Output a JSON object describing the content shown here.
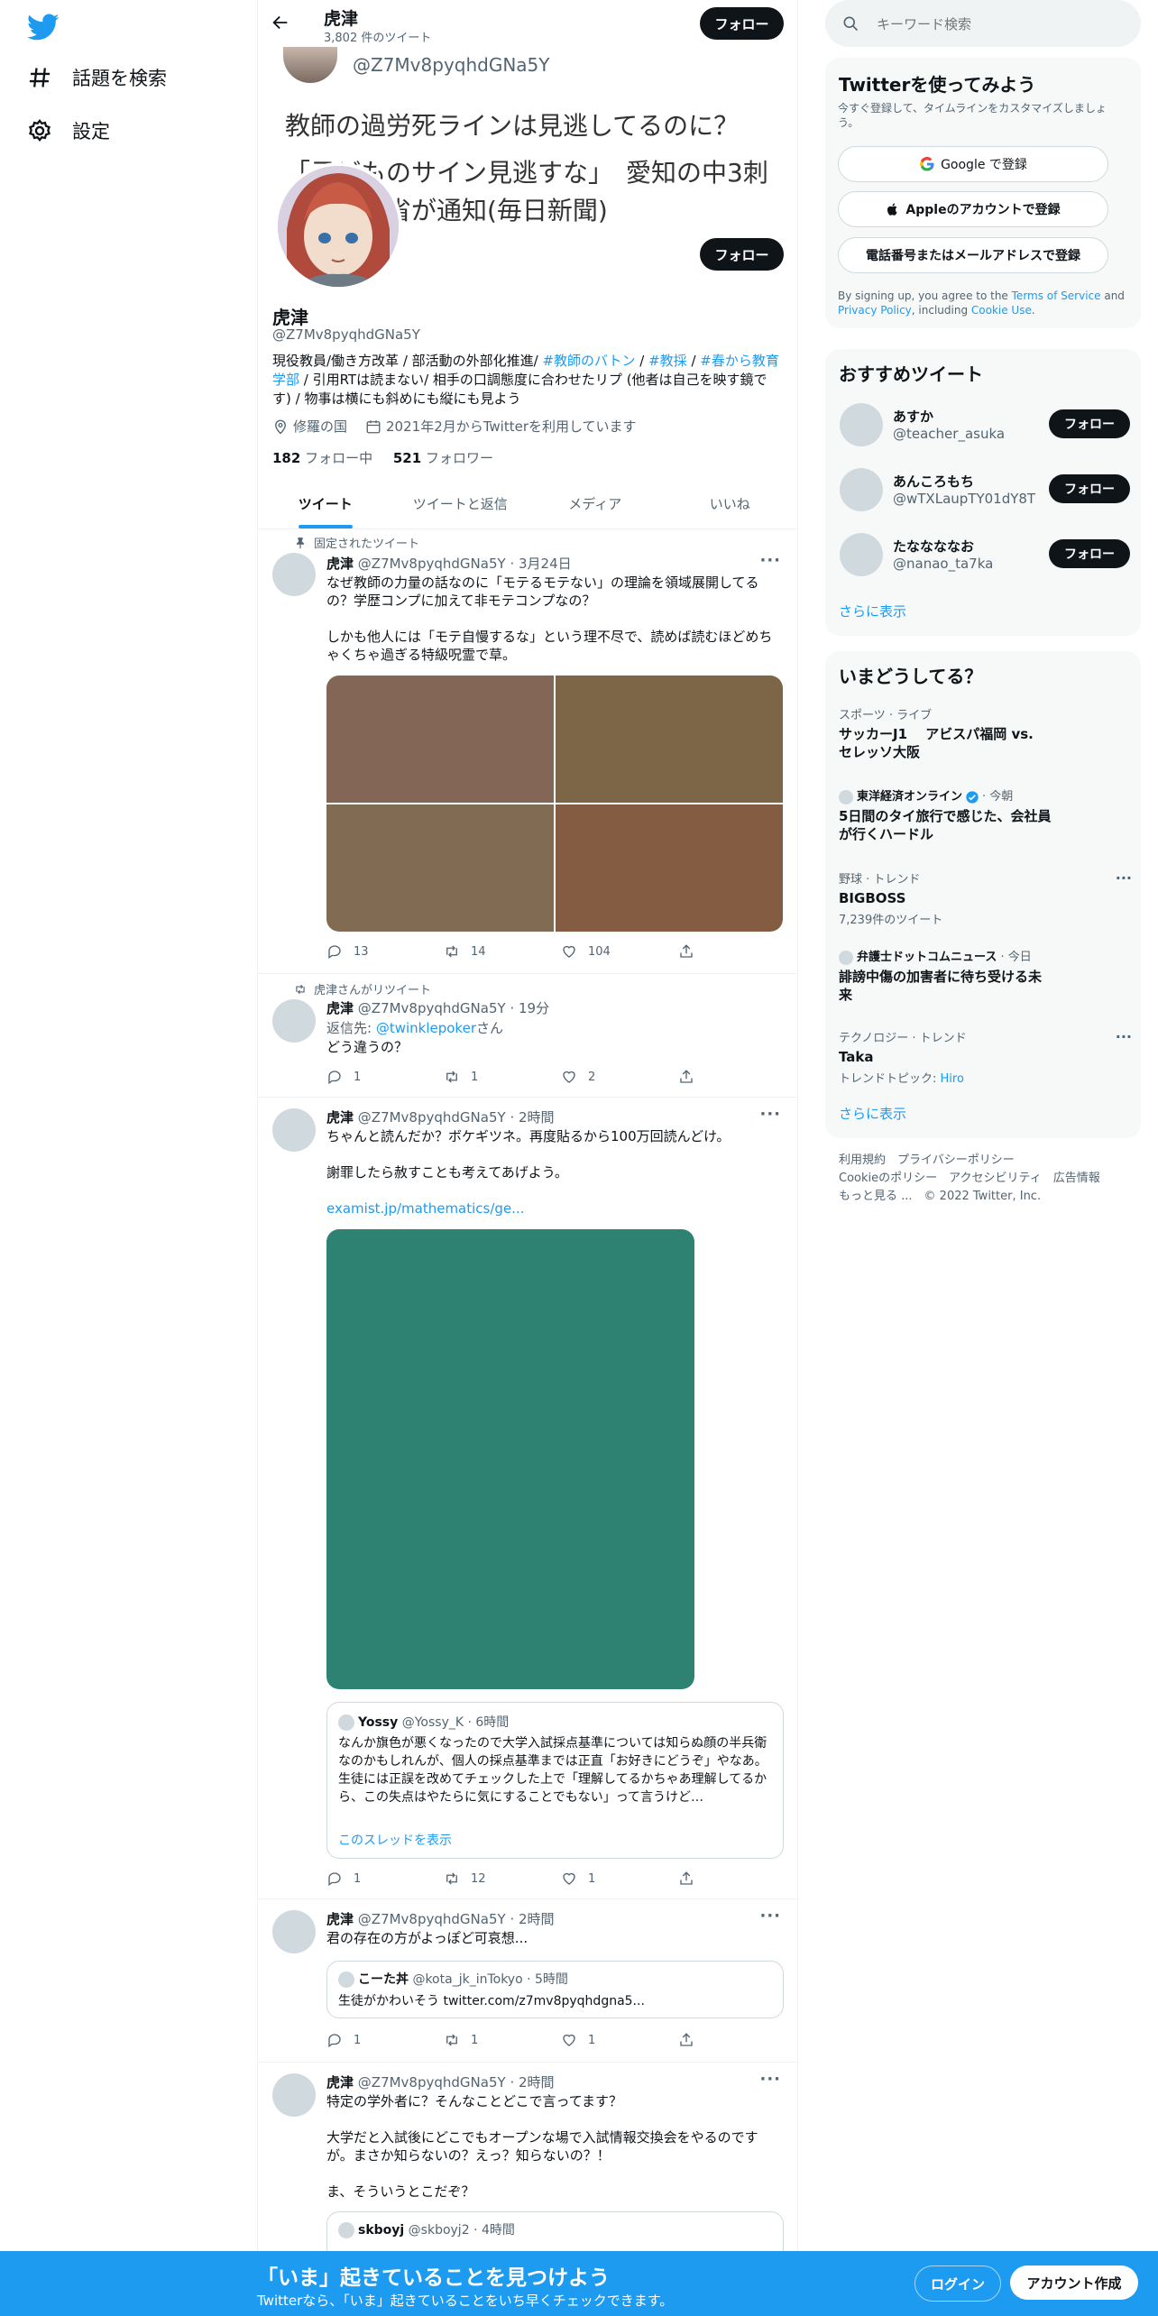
{
  "nav": {
    "explore": "話題を検索",
    "settings": "設定"
  },
  "header": {
    "name": "虎津",
    "tweet_count": "3,802 件のツイート",
    "follow": "フォロー"
  },
  "banner": {
    "handle": "@Z7Mv8pyqhdGNa5Y",
    "line1": "教師の過労死ラインは見逃してるのに？",
    "line2": "「子どものサイン見逃すな」　愛知の中3刺",
    "line3": "殺　文科省が通知(毎日新聞)"
  },
  "profile": {
    "name": "虎津",
    "handle": "@Z7Mv8pyqhdGNa5Y",
    "follow": "フォロー",
    "bio_part1": "現役教員/働き方改革 / 部活動の外部化推進/ ",
    "bio_tag1": "#教師のバトン",
    "bio_sep1": " / ",
    "bio_tag2": "#教採",
    "bio_sep2": " / ",
    "bio_tag3": "#春から教育学部",
    "bio_part2": " / 引用RTは読まない/ 相手の口調態度に合わせたリプ (他者は自己を映す鏡です) / 物事は横にも斜めにも縦にも見よう",
    "location": "修羅の国",
    "joined": "2021年2月からTwitterを利用しています",
    "following_count": "182",
    "following_label": " フォロー中",
    "followers_count": "521",
    "followers_label": " フォロワー"
  },
  "tabs": [
    "ツイート",
    "ツイートと返信",
    "メディア",
    "いいね"
  ],
  "tweets": [
    {
      "context": "固定されたツイート",
      "name": "虎津",
      "handle": "@Z7Mv8pyqhdGNa5Y",
      "time": "· 3月24日",
      "text": "なぜ教師の力量の話なのに「モテるモテない」の理論を領域展開してるの？学歴コンプに加えて非モテコンプなの？\n\nしかも他人には「モテ自慢するな」という理不尽で、読めば読むほどめちゃくちゃ過ぎる特級呪霊で草。",
      "images": [
        "#836656",
        "#7d6647",
        "#816b52",
        "#845c41"
      ],
      "replies": "13",
      "retweets": "14",
      "likes": "104"
    },
    {
      "context": "虎津さんがリツイート",
      "name": "虎津",
      "handle": "@Z7Mv8pyqhdGNa5Y",
      "time": "· 19分",
      "reply_prefix": "返信先: ",
      "reply_to": "@twinklepoker",
      "reply_suffix": "さん",
      "text": "どう違うの？",
      "replies": "1",
      "retweets": "1",
      "likes": "2"
    },
    {
      "name": "虎津",
      "handle": "@Z7Mv8pyqhdGNa5Y",
      "time": "· 2時間",
      "text": "ちゃんと読んだか？ボケギツネ。再度貼るから100万回読んどけ。\n\n謝罪したら赦すことも考えてあげよう。",
      "link": "examist.jp/mathematics/ge...",
      "image_color": "#2e8272",
      "quote": {
        "name": "Yossy",
        "handle": "@Yossy_K",
        "time": "· 6時間",
        "text": "なんか旗色が悪くなったので大学入試採点基準については知らぬ顔の半兵衛なのかもしれんが、個人の採点基準までは正直「お好きにどうぞ」やなあ。\n生徒には正誤を改めてチェックした上で「理解してるかちゃあ理解してるから、この失点はやたらに気にすることでもない」って言うけど…",
        "show_thread": "このスレッドを表示"
      },
      "replies": "1",
      "retweets": "12",
      "likes": "1"
    },
    {
      "name": "虎津",
      "handle": "@Z7Mv8pyqhdGNa5Y",
      "time": "· 2時間",
      "text": "君の存在の方がよっぽど可哀想...",
      "quote": {
        "name": "こーた丼",
        "handle": "@kota_jk_inTokyo",
        "time": "· 5時間",
        "text": "生徒がかわいそう twitter.com/z7mv8pyqhdgna5..."
      },
      "replies": "1",
      "retweets": "1",
      "likes": "1"
    },
    {
      "name": "虎津",
      "handle": "@Z7Mv8pyqhdGNa5Y",
      "time": "· 2時間",
      "text": "特定の学外者に？そんなことどこで言ってます？\n\n大学だと入試後にどこでもオープンな場で入試情報交換会をやるのですが。まさか知らないの？えっ？知らないの？！\n\nま、そういうとこだぞ？",
      "quote": {
        "name": "skboyj",
        "handle": "@skboyj2",
        "time": "· 4時間"
      }
    }
  ],
  "search": {
    "placeholder": "キーワード検索"
  },
  "signup": {
    "title": "Twitterを使ってみよう",
    "subtitle": "今すぐ登録して、タイムラインをカスタマイズしましょう。",
    "google": "Google で登録",
    "apple": "Appleのアカウントで登録",
    "phone": "電話番号またはメールアドレスで登録",
    "terms_pre": "By signing up, you agree to the ",
    "terms_link": "Terms of Service",
    "terms_and": " and ",
    "privacy_link": "Privacy Policy",
    "terms_including": ", including ",
    "cookie_link": "Cookie Use",
    "terms_end": "."
  },
  "suggested": {
    "title": "おすすめツイート",
    "users": [
      {
        "name": "あすか",
        "handle": "@teacher_asuka"
      },
      {
        "name": "あんころもち",
        "handle": "@wTXLaupTY01dY8T"
      },
      {
        "name": "たななななお",
        "handle": "@nanao_ta7ka"
      }
    ],
    "follow": "フォロー",
    "show_more": "さらに表示"
  },
  "trends": {
    "title": "いまどうしてる？",
    "items": [
      {
        "category": "スポーツ · ライブ",
        "title": "サッカーJ1　 アビスパ福岡 vs.\nセレッソ大阪"
      },
      {
        "source": "東洋経済オンライン",
        "time": "· 今朝",
        "title": "5日間のタイ旅行で感じた、会社員\nが行くハードル"
      },
      {
        "category": "野球 · トレンド",
        "title": "BIGBOSS",
        "sub": "7,239件のツイート"
      },
      {
        "source": "弁護士ドットコムニュース",
        "time": "· 今日",
        "title": "誹謗中傷の加害者に待ち受ける未\n来"
      },
      {
        "category": "テクノロジー · トレンド",
        "title": "Taka",
        "sub_prefix": "トレンドトピック: ",
        "sub_link": "Hiro"
      }
    ],
    "show_more": "さらに表示"
  },
  "footer": {
    "terms": "利用規約",
    "privacy": "プライバシーポリシー",
    "cookie": "Cookieのポリシー",
    "accessibility": "アクセシビリティ",
    "ads": "広告情報",
    "more": "もっと見る ...",
    "copyright": "© 2022 Twitter, Inc."
  },
  "bottom": {
    "title": "「いま」起きていることを見つけよう",
    "subtitle": "Twitterなら、「いま」起きていることをいち早くチェックできます。",
    "login": "ログイン",
    "signup": "アカウント作成"
  },
  "colors": {
    "accent": "#1d9bf0",
    "verified": "#1d9bf0",
    "bottom_bar": "#1d9bf0"
  }
}
